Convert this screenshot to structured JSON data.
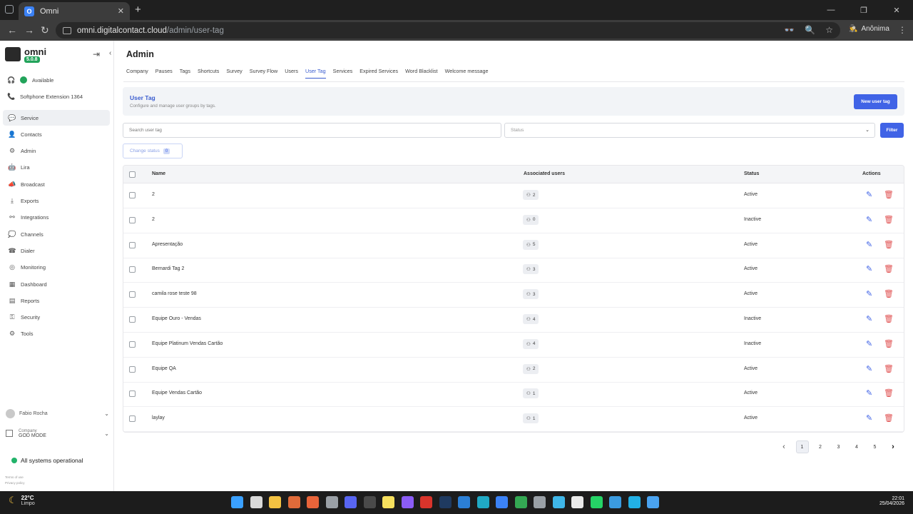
{
  "browser": {
    "tab_title": "Omni",
    "tab_favicon": "O",
    "url_host": "omni.digitalcontact.cloud",
    "url_path": "/admin/user-tag",
    "profile_label": "Anônima"
  },
  "sidebar": {
    "brand": "omni",
    "version": "5.0.8",
    "availability": "Available",
    "softphone": "Softphone Extension 1364",
    "items": [
      {
        "label": "Service",
        "icon": "chat-icon"
      },
      {
        "label": "Contacts",
        "icon": "contacts-icon"
      },
      {
        "label": "Admin",
        "icon": "admin-icon"
      },
      {
        "label": "Lira",
        "icon": "bot-icon"
      },
      {
        "label": "Broadcast",
        "icon": "broadcast-icon"
      },
      {
        "label": "Exports",
        "icon": "download-icon"
      },
      {
        "label": "Integrations",
        "icon": "integrations-icon"
      },
      {
        "label": "Channels",
        "icon": "channels-icon"
      },
      {
        "label": "Dialer",
        "icon": "dialer-icon"
      },
      {
        "label": "Monitoring",
        "icon": "monitoring-icon"
      },
      {
        "label": "Dashboard",
        "icon": "dashboard-icon"
      },
      {
        "label": "Reports",
        "icon": "reports-icon"
      },
      {
        "label": "Security",
        "icon": "key-icon"
      },
      {
        "label": "Tools",
        "icon": "gear-icon"
      }
    ],
    "user_name": "Fabio Rocha",
    "company_label": "Company",
    "company_value": "GOD MODE",
    "system_status": "All systems operational",
    "terms": "Terms of use",
    "privacy": "Privacy policy"
  },
  "main": {
    "title": "Admin",
    "tabs": [
      "Company",
      "Pauses",
      "Tags",
      "Shortcuts",
      "Survey",
      "Survey Flow",
      "Users",
      "User Tag",
      "Services",
      "Expired Services",
      "Word Blacklist",
      "Welcome message"
    ],
    "active_tab": "User Tag",
    "panel_title": "User Tag",
    "panel_subtitle": "Configure and manage user groups by tags.",
    "new_button": "New user tag",
    "search_placeholder": "Search user tag",
    "status_placeholder": "Status",
    "filter_button": "Filter",
    "change_status_button": "Change status",
    "change_status_count": "0",
    "columns": {
      "name": "Name",
      "users": "Associated users",
      "status": "Status",
      "actions": "Actions"
    },
    "rows": [
      {
        "name": "2",
        "users": "2",
        "status": "Active"
      },
      {
        "name": "2",
        "users": "0",
        "status": "Inactive"
      },
      {
        "name": "Apresentação",
        "users": "5",
        "status": "Active"
      },
      {
        "name": "Bernardi Tag 2",
        "users": "3",
        "status": "Active"
      },
      {
        "name": "camila rose teste 98",
        "users": "3",
        "status": "Active"
      },
      {
        "name": "Equipe Ouro - Vendas",
        "users": "4",
        "status": "Inactive"
      },
      {
        "name": "Equipe Platinum Vendas Cartão",
        "users": "4",
        "status": "Inactive"
      },
      {
        "name": "Equipe QA",
        "users": "2",
        "status": "Active"
      },
      {
        "name": "Equipe Vendas Cartão",
        "users": "1",
        "status": "Active"
      },
      {
        "name": "laylay",
        "users": "1",
        "status": "Active"
      }
    ],
    "pages": [
      "1",
      "2",
      "3",
      "4",
      "5"
    ],
    "current_page": "1"
  },
  "taskbar": {
    "temperature": "22°C",
    "weather": "Limpo",
    "time": "22:01",
    "date": "25/04/2026"
  },
  "colors": {
    "accent": "#4063e6",
    "active_status": "#22a35a",
    "delete": "#e05252"
  }
}
